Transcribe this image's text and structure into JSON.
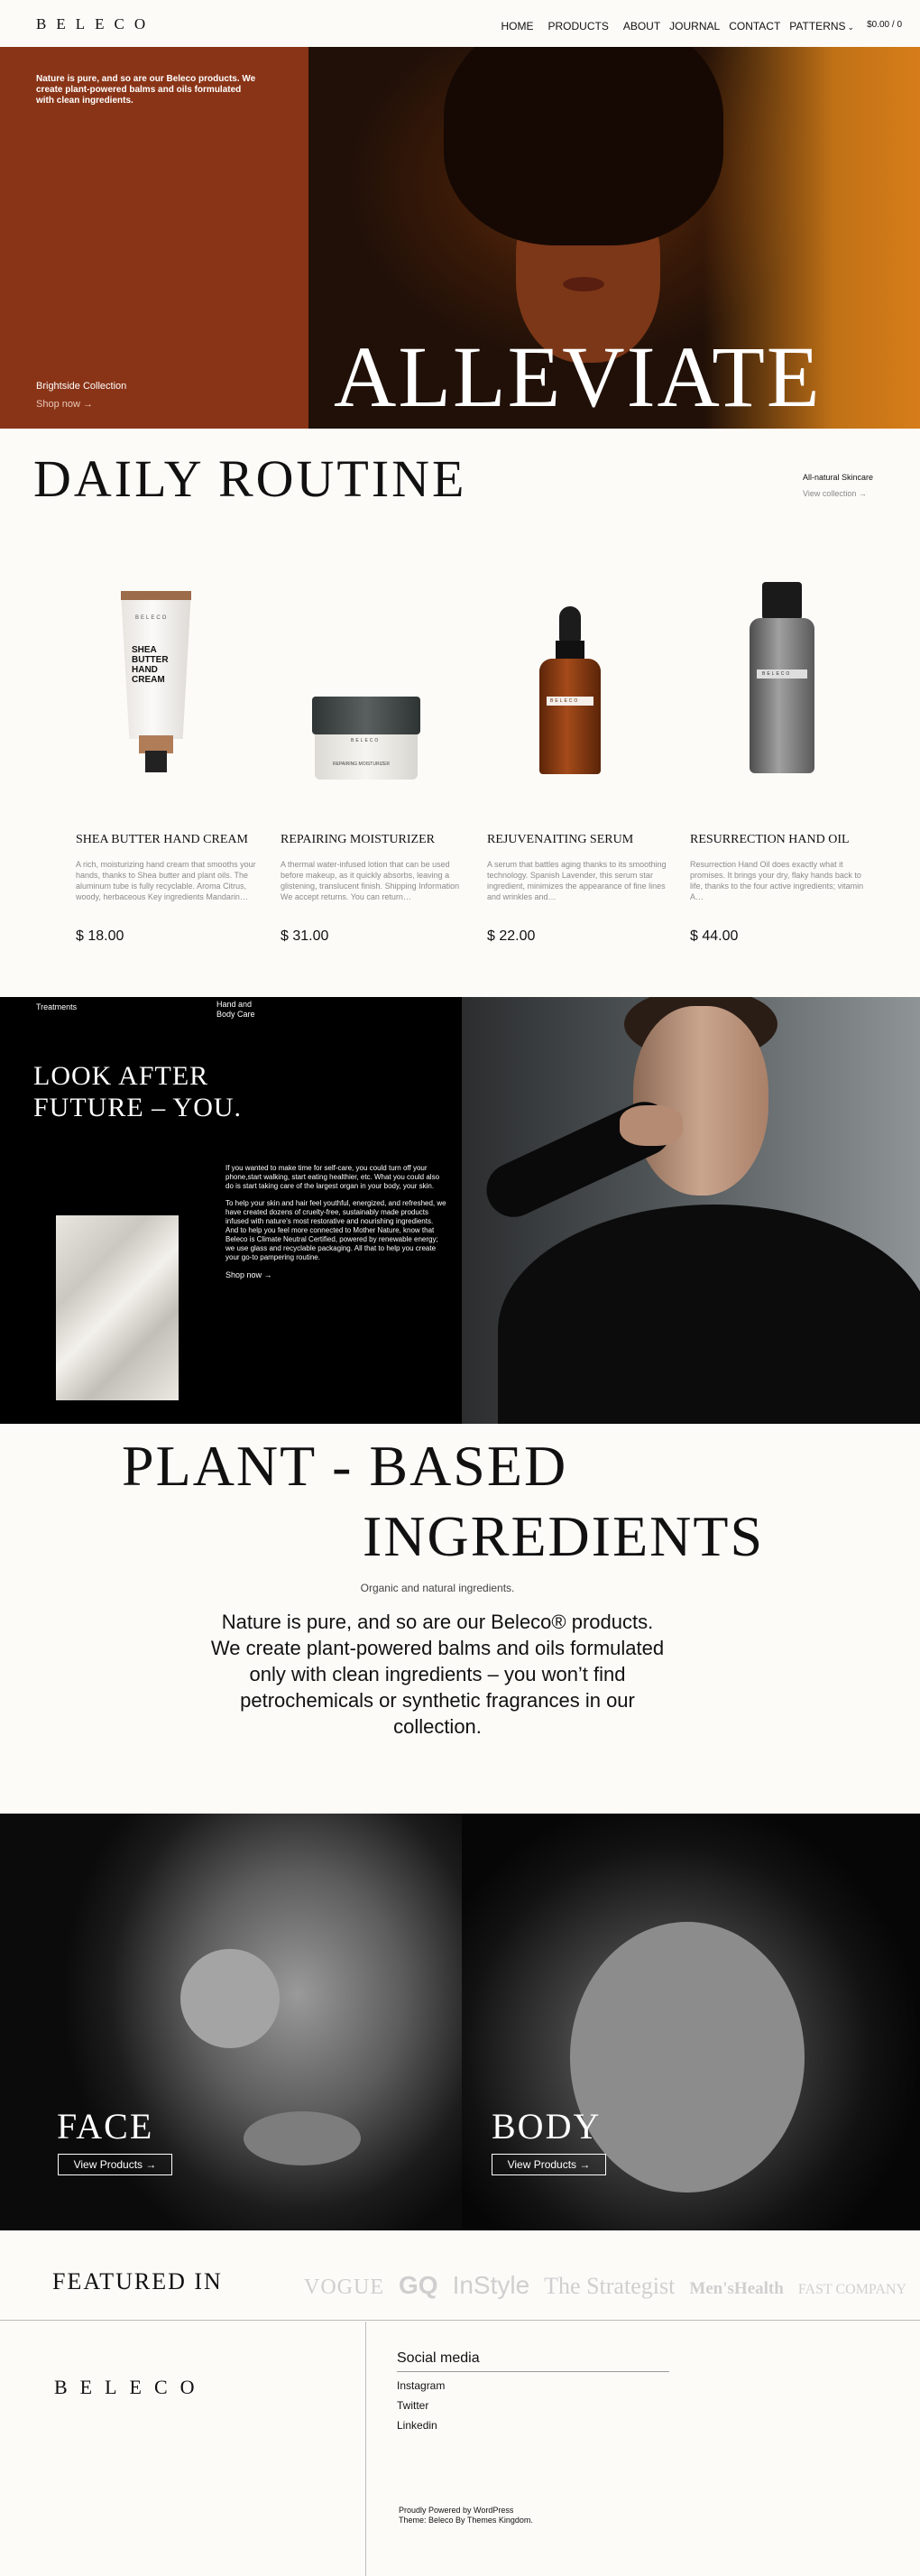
{
  "header": {
    "logo": "BELECO",
    "nav": [
      "HOME",
      "PRODUCTS",
      "ABOUT",
      "JOURNAL",
      "CONTACT",
      "PATTERNS"
    ],
    "cart": "$0.00 / 0"
  },
  "hero": {
    "intro": "Nature is pure, and so are our Beleco products. We create plant-powered balms and oils formulated with clean ingredients.",
    "collection": "Brightside Collection",
    "shop_now": "Shop now",
    "headline": "ALLEVIATE"
  },
  "routine": {
    "title": "DAILY ROUTINE",
    "side_label": "All-natural Skincare",
    "view_collection": "View collection",
    "products": [
      {
        "name": "SHEA BUTTER HAND CREAM",
        "desc": "A rich, moisturizing hand cream that smooths your hands, thanks to Shea butter and plant oils. The aluminum tube is fully recyclable. Aroma Citrus, woody, herbaceous Key ingredients Mandarin…",
        "price": "$ 18.00",
        "pack_label": "SHEA BUTTER HAND CREAM",
        "brand": "BELECO"
      },
      {
        "name": "REPAIRING MOISTURIZER",
        "desc": "A thermal water-infused lotion that can be used before makeup, as it quickly absorbs, leaving a glistening, translucent finish. Shipping Information We accept returns. You can return…",
        "price": "$ 31.00",
        "pack_label": "REPAIRING MOISTURIZER",
        "brand": "BELECO"
      },
      {
        "name": "REJUVENAITING SERUM",
        "desc": "A serum that battles aging thanks to its smoothing technology. Spanish Lavender, this serum star ingredient, minimizes the appearance of fine lines and wrinkles and…",
        "price": "$ 22.00",
        "brand": "BELECO"
      },
      {
        "name": "RESURRECTION HAND OIL",
        "desc": "Resurrection Hand Oil does exactly what it promises. It brings your dry, flaky hands back to life, thanks to the four active ingredients; vitamin A…",
        "price": "$ 44.00",
        "brand": "BELECO"
      }
    ]
  },
  "look": {
    "tag1": "Treatments",
    "tag2": "Hand and Body Care",
    "title_line1": "LOOK AFTER",
    "title_line2": "FUTURE – YOU.",
    "para1": "If you wanted to make time for self-care, you could turn off your phone,start walking, start eating healthier, etc. What you could also do is start taking care of the largest organ in your body, your skin.",
    "para2": "To help your skin and hair feel youthful, energized, and refreshed, we have created dozens of cruelty-free, sustainably made products infused with nature’s most restorative and nourishing ingredients. And to help you feel more connected to Mother Nature, know that Beleco is Climate Neutral Certified, powered by renewable energy; we use glass and recyclable packaging. All that to help you create your go-to pampering routine.",
    "shop_now": "Shop now"
  },
  "plant": {
    "line1": "PLANT - BASED",
    "line2": "INGREDIENTS",
    "subtitle": "Organic and natural ingredients.",
    "text": "Nature is pure, and so are our Beleco® products. We create plant-powered balms and oils formulated only with clean ingredients – you won’t find petrochemicals or synthetic fragrances in our collection."
  },
  "categories": [
    {
      "label": "FACE",
      "button": "View Products"
    },
    {
      "label": "BODY",
      "button": "View Products"
    }
  ],
  "featured": {
    "title": "FEATURED IN",
    "logos": [
      "VOGUE",
      "GQ",
      "InStyle",
      "The Strategist",
      "Men'sHealth",
      "FAST COMPANY"
    ]
  },
  "footer": {
    "logo": "BELECO",
    "social_title": "Social media",
    "social": [
      "Instagram",
      "Twitter",
      "Linkedin"
    ],
    "credit1": "Proudly Powered by WordPress",
    "credit2": "Theme: Beleco By Themes Kingdom."
  },
  "colors": {
    "hero_panel": "#8a3417",
    "background": "#fcfbf8",
    "dark_panel": "#000000"
  }
}
